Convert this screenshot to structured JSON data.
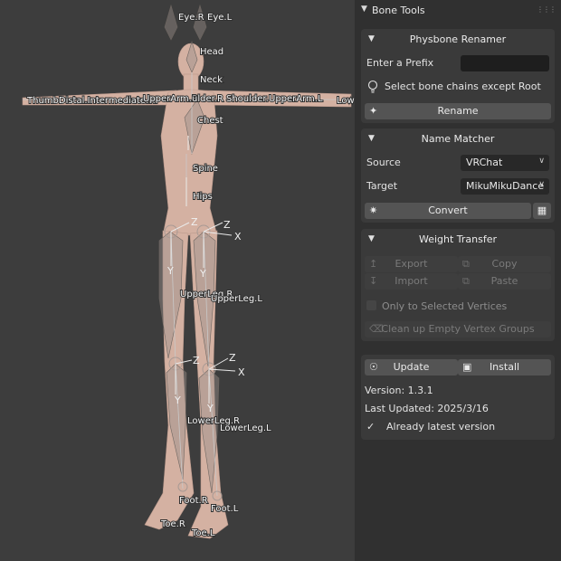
{
  "viewport": {
    "bones": {
      "eye_r": "Eye.R",
      "eye_l": "Eye.L",
      "head": "Head",
      "neck": "Neck",
      "chest": "Chest",
      "spine": "Spine",
      "hips": "Hips",
      "arm_cluster": "ThumbDistal.ᵉᵈᵈⁱᵃᵗᵉ.R UpperArm.Rulder.RShoulder.UpperArm.L",
      "arm_left_text": "ThumbDistal.Intermediate.R",
      "upper_arm_r": "UpperArm.R",
      "shoulder_r": "ulder.R",
      "shoulder_l": "Shoulder.",
      "upper_arm_l": "UpperArm.L",
      "lower_arm_l": "Low",
      "upper_leg_r": "UpperLeg.R",
      "upper_leg_l": "UpperLeg.L",
      "lower_leg_r": "LowerLeg.R",
      "lower_leg_l": "LowerLeg.L",
      "foot_r": "Foot.R",
      "foot_l": "Foot.L",
      "toe_r": "Toe.R",
      "toe_l": "Toe.L"
    },
    "axes": {
      "x": "X",
      "y": "Y",
      "z": "Z"
    }
  },
  "panel": {
    "title": "Bone Tools",
    "physbone_renamer": {
      "title": "Physbone Renamer",
      "prefix_label": "Enter a Prefix",
      "prefix_value": "",
      "info_text": "Select bone chains except Root",
      "rename_button": "Rename"
    },
    "name_matcher": {
      "title": "Name Matcher",
      "source_label": "Source",
      "source_value": "VRChat",
      "target_label": "Target",
      "target_value": "MikuMikuDance",
      "convert_button": "Convert"
    },
    "weight_transfer": {
      "title": "Weight Transfer",
      "export_button": "Export",
      "copy_button": "Copy",
      "import_button": "Import",
      "paste_button": "Paste",
      "only_selected_label": "Only to Selected Vertices",
      "only_selected_checked": false,
      "cleanup_button": "Clean up Empty Vertex Groups"
    },
    "updater": {
      "update_button": "Update",
      "install_button": "Install",
      "version": "Version: 1.3.1",
      "last_updated": "Last Updated: 2025/3/16",
      "status": "Already latest version"
    }
  }
}
